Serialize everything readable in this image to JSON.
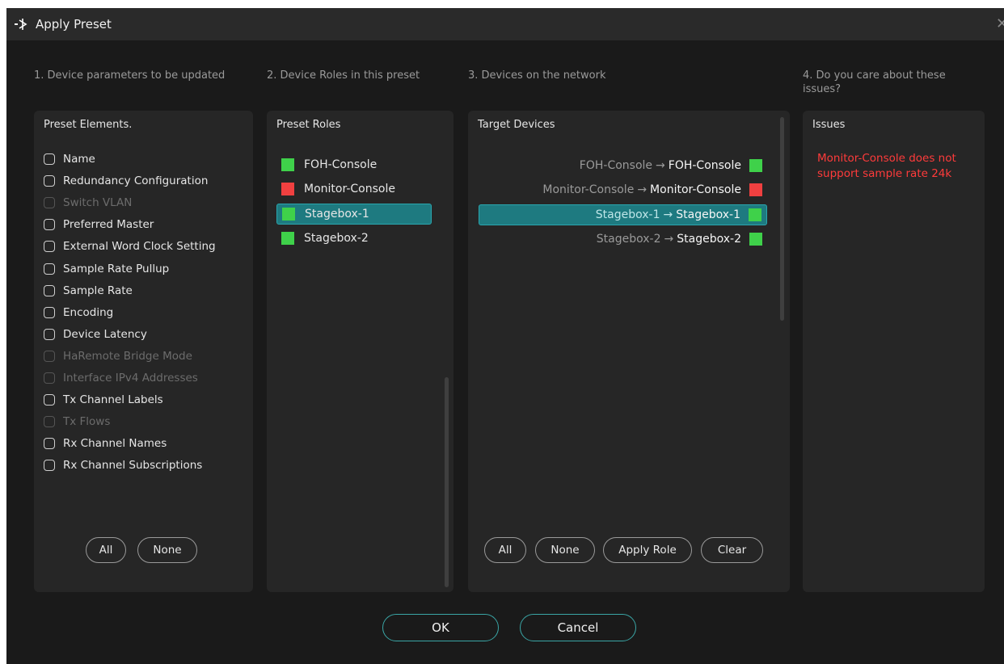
{
  "window": {
    "title": "Apply Preset",
    "close_glyph": "✕"
  },
  "columns": {
    "col1_header": "1. Device parameters to be updated",
    "col2_header": "2. Device Roles in this preset",
    "col3_header": "3. Devices on the network",
    "col4_header": "4. Do you care about these issues?"
  },
  "preset_elements": {
    "title": "Preset Elements.",
    "items": [
      {
        "label": "Name",
        "enabled": true,
        "checked": false
      },
      {
        "label": "Redundancy Configuration",
        "enabled": true,
        "checked": false
      },
      {
        "label": "Switch VLAN",
        "enabled": false,
        "checked": false
      },
      {
        "label": "Preferred Master",
        "enabled": true,
        "checked": false
      },
      {
        "label": "External Word Clock Setting",
        "enabled": true,
        "checked": false
      },
      {
        "label": "Sample Rate Pullup",
        "enabled": true,
        "checked": false
      },
      {
        "label": "Sample Rate",
        "enabled": true,
        "checked": false
      },
      {
        "label": "Encoding",
        "enabled": true,
        "checked": false
      },
      {
        "label": "Device Latency",
        "enabled": true,
        "checked": false
      },
      {
        "label": "HaRemote Bridge Mode",
        "enabled": false,
        "checked": false
      },
      {
        "label": "Interface IPv4 Addresses",
        "enabled": false,
        "checked": false
      },
      {
        "label": "Tx Channel Labels",
        "enabled": true,
        "checked": false
      },
      {
        "label": "Tx Flows",
        "enabled": false,
        "checked": false
      },
      {
        "label": "Rx Channel Names",
        "enabled": true,
        "checked": false
      },
      {
        "label": "Rx Channel Subscriptions",
        "enabled": true,
        "checked": false
      }
    ],
    "all_label": "All",
    "none_label": "None"
  },
  "preset_roles": {
    "title": "Preset Roles",
    "items": [
      {
        "label": "FOH-Console",
        "status_color": "#3fd14a",
        "selected": false
      },
      {
        "label": "Monitor-Console",
        "status_color": "#f04040",
        "selected": false
      },
      {
        "label": "Stagebox-1",
        "status_color": "#3fd14a",
        "selected": true
      },
      {
        "label": "Stagebox-2",
        "status_color": "#3fd14a",
        "selected": false
      }
    ]
  },
  "target_devices": {
    "title": "Target Devices",
    "items": [
      {
        "from": "FOH-Console",
        "arrow": "→",
        "to": "FOH-Console",
        "status_color": "#3fd14a",
        "selected": false
      },
      {
        "from": "Monitor-Console",
        "arrow": "→",
        "to": "Monitor-Console",
        "status_color": "#f04040",
        "selected": false
      },
      {
        "from": "Stagebox-1",
        "arrow": "→",
        "to": "Stagebox-1",
        "status_color": "#3fd14a",
        "selected": true
      },
      {
        "from": "Stagebox-2",
        "arrow": "→",
        "to": "Stagebox-2",
        "status_color": "#3fd14a",
        "selected": false
      }
    ],
    "all_label": "All",
    "none_label": "None",
    "apply_role_label": "Apply Role",
    "clear_label": "Clear"
  },
  "issues": {
    "title": "Issues",
    "message": "Monitor-Console does not support sample rate 24k"
  },
  "footer": {
    "ok_label": "OK",
    "cancel_label": "Cancel"
  },
  "colors": {
    "accent": "#1e7a80",
    "ok_green": "#3fd14a",
    "error_red": "#f04040"
  }
}
